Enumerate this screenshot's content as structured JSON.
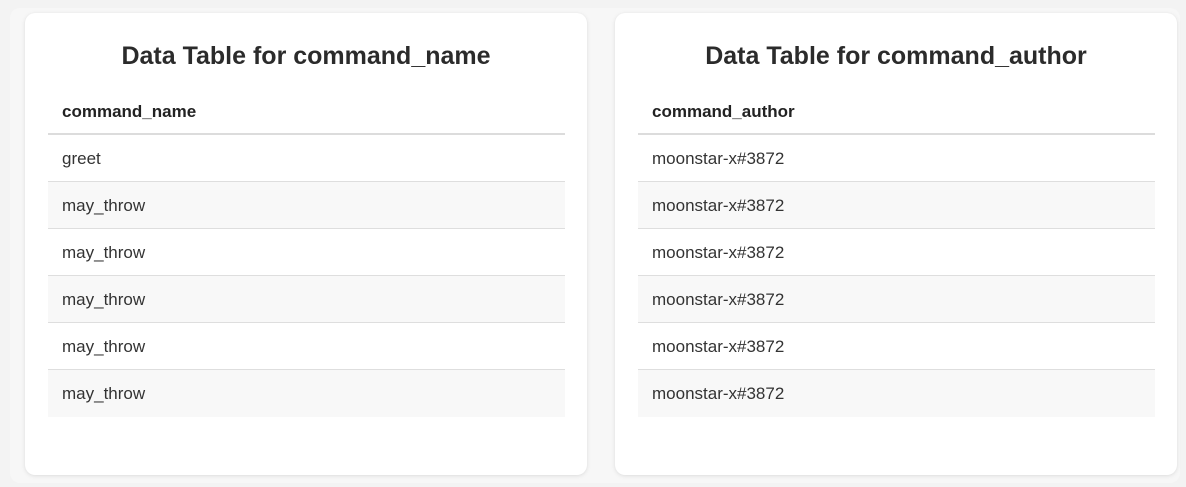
{
  "tables": [
    {
      "title": "Data Table for command_name",
      "header": "command_name",
      "rows": [
        "greet",
        "may_throw",
        "may_throw",
        "may_throw",
        "may_throw",
        "may_throw"
      ]
    },
    {
      "title": "Data Table for command_author",
      "header": "command_author",
      "rows": [
        "moonstar-x#3872",
        "moonstar-x#3872",
        "moonstar-x#3872",
        "moonstar-x#3872",
        "moonstar-x#3872",
        "moonstar-x#3872"
      ]
    }
  ]
}
